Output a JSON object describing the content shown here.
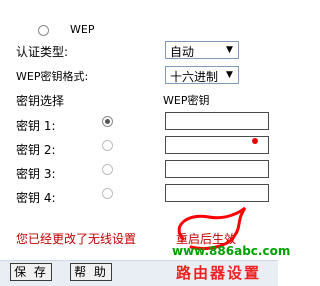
{
  "wep_option": {
    "label": "WEP"
  },
  "auth_type": {
    "label": "认证类型:",
    "value": "自动"
  },
  "key_format": {
    "label": "WEP密钥格式:",
    "value": "十六进制"
  },
  "headers": {
    "key_select": "密钥选择",
    "wep_key": "WEP密钥"
  },
  "keys": [
    {
      "label": "密钥 1:",
      "selected": true,
      "value": ""
    },
    {
      "label": "密钥 2:",
      "selected": false,
      "value": ""
    },
    {
      "label": "密钥 3:",
      "selected": false,
      "value": ""
    },
    {
      "label": "密钥 4:",
      "selected": false,
      "value": ""
    }
  ],
  "warning_text": "您已经更改了无线设置",
  "warning_link": "重启后生效",
  "buttons": {
    "save": "保 存",
    "help": "帮 助"
  },
  "watermark": {
    "url": "www.886abc.com",
    "text": "路由器设置"
  },
  "colors": {
    "warning": "#c00000",
    "watermark_url": "#00a000",
    "watermark_text": "#ee2222",
    "highlight_circle": "#ff0000"
  }
}
